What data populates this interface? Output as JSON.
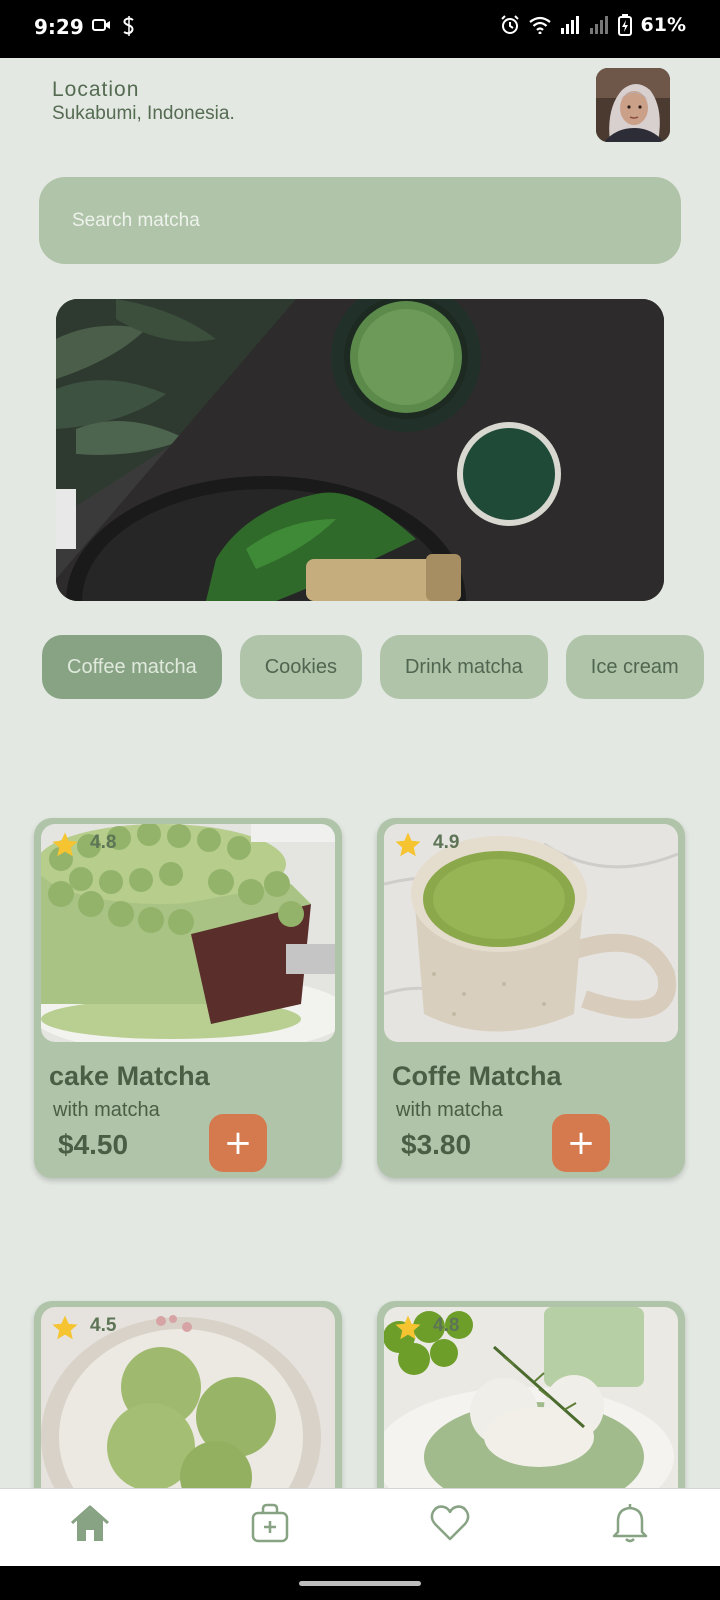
{
  "status_bar": {
    "time": "9:29",
    "battery": "61%",
    "icons": [
      "video-icon",
      "s-app-icon",
      "alarm-icon",
      "wifi-icon",
      "signal-icon",
      "signal-icon",
      "battery-charging-icon"
    ]
  },
  "header": {
    "location_label": "Location",
    "location_value": "Sukabumi, Indonesia."
  },
  "search": {
    "placeholder": "Search matcha"
  },
  "categories": [
    {
      "label": "Coffee matcha",
      "active": true
    },
    {
      "label": "Cookies",
      "active": false
    },
    {
      "label": "Drink matcha",
      "active": false
    },
    {
      "label": "Ice cream",
      "active": false
    }
  ],
  "products": [
    {
      "name": "cake Matcha",
      "subtitle": "with matcha",
      "price": "$4.50",
      "rating": "4.8",
      "add_label": "+"
    },
    {
      "name": "Coffe Matcha",
      "subtitle": "with matcha",
      "price": "$3.80",
      "rating": "4.9",
      "add_label": "+"
    },
    {
      "name": "",
      "subtitle": "",
      "price": "",
      "rating": "4.5",
      "add_label": "+"
    },
    {
      "name": "",
      "subtitle": "",
      "price": "",
      "rating": "4.8",
      "add_label": "+"
    }
  ],
  "bottom_nav": {
    "items": [
      "home-icon",
      "bag-icon",
      "heart-icon",
      "bell-icon"
    ],
    "active": "home-icon"
  },
  "colors": {
    "background": "#e3e9e2",
    "accent": "#b0c4a9",
    "active_chip": "#88a384",
    "add_button": "#d57a4f",
    "text_dark": "#4a5e45"
  }
}
